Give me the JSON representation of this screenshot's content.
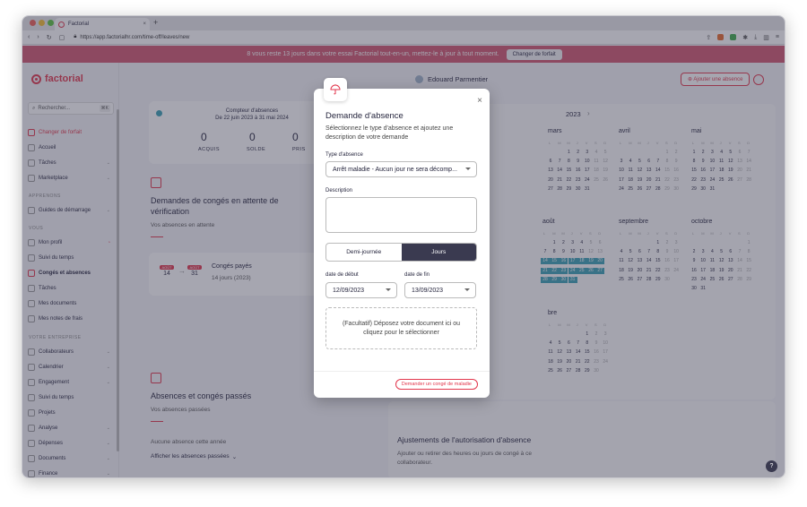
{
  "browser": {
    "tab_title": "Factorial",
    "url": "https://app.factorialhr.com/time-off/leaves/new"
  },
  "banner": {
    "text": "8 vous reste 13 jours dans votre essai Factorial tout-en-un, mettez-le à jour à tout moment.",
    "button": "Changer de forfait"
  },
  "sidebar": {
    "logo": "factorial",
    "search_placeholder": "Rechercher...",
    "search_shortcut": "⌘K",
    "items_top": [
      "Changer de forfait",
      "Accueil",
      "Tâches",
      "Marketplace"
    ],
    "section_apprenons": "APPRENONS",
    "item_guides": "Guides de démarrage",
    "section_vous": "VOUS",
    "items_vous": [
      "Mon profil",
      "Suivi du temps",
      "Congés et absences",
      "Tâches",
      "Mes documents",
      "Mes notes de frais"
    ],
    "section_entreprise": "VOTRE ENTREPRISE",
    "items_entreprise": [
      "Collaborateurs",
      "Calendrier",
      "Engagement",
      "Suivi du temps",
      "Projets",
      "Analyse",
      "Dépenses",
      "Documents",
      "Finance"
    ]
  },
  "header": {
    "user": "Edouard Parmentier",
    "add_button": "Ajouter une absence"
  },
  "counter": {
    "title": "Compteur d'absences",
    "period": "De 22 juin 2023 à 31 mai 2024",
    "acquis_value": "0",
    "acquis_label": "ACQUIS",
    "solde_value": "0",
    "solde_label": "SOLDE",
    "pris_value": "0",
    "pris_label": "PRIS"
  },
  "pending": {
    "title": "Demandes de congés en attente de vérification",
    "subtitle": "Vos absences en attente",
    "from_month": "AOÛT",
    "from_day": "14",
    "to_month": "AOÛT",
    "to_day": "31",
    "leave_title": "Congés payés",
    "leave_detail": "14 jours (2023)"
  },
  "past": {
    "title": "Absences et congés passés",
    "subtitle": "Vos absences passées",
    "empty": "Aucune absence cette année",
    "show": "Afficher les absences passées"
  },
  "adjust": {
    "title": "Ajustements de l'autorisation d'absence",
    "text": "Ajouter ou retirer des heures ou jours de congé à ce collaborateur."
  },
  "calendar": {
    "year": "2023",
    "months": [
      "mars",
      "avril",
      "mai",
      "août",
      "septembre",
      "octobre",
      "bre"
    ],
    "weekdays": [
      "L",
      "M",
      "M",
      "J",
      "V",
      "S",
      "D"
    ]
  },
  "modal": {
    "title": "Demande d'absence",
    "subtitle": "Sélectionnez le type d'absence et ajoutez une description de votre demande",
    "type_label": "Type d'absence",
    "type_value": "Arrêt maladie - Aucun jour ne sera décomp...",
    "description_label": "Description",
    "half_day": "Demi-journée",
    "days": "Jours",
    "start_label": "date de début",
    "start_value": "12/09/2023",
    "end_label": "date de fin",
    "end_value": "13/09/2023",
    "dropzone": "(Facultatif) Déposez votre document ici ou cliquez pour le sélectionner",
    "submit": "Demander un congé de maladie"
  },
  "colors": {
    "brand": "#e2364c",
    "banner": "#d1566f",
    "highlight": "#3aa0b4",
    "dark": "#3a3a50"
  }
}
